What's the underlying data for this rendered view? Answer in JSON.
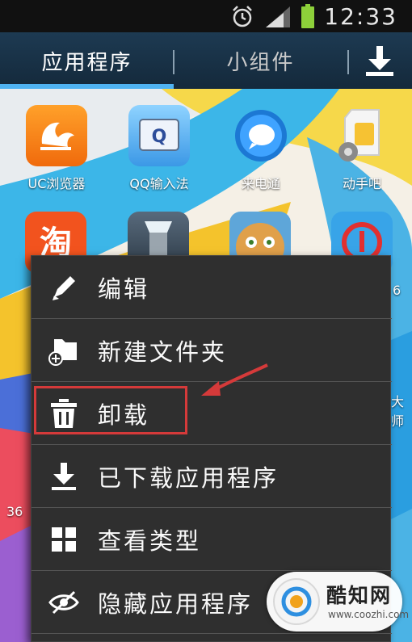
{
  "status_bar": {
    "time": "12:33",
    "icons": [
      "alarm-clock-icon",
      "signal-icon",
      "battery-icon"
    ]
  },
  "tabs": {
    "apps_label": "应用程序",
    "widgets_label": "小组件",
    "download_icon": "download-icon",
    "active_color": "#4fb3f2"
  },
  "apps_row1": [
    {
      "label": "UC浏览器",
      "icon": "uc-browser-icon"
    },
    {
      "label": "QQ输入法",
      "icon": "qq-input-icon"
    },
    {
      "label": "来电通",
      "icon": "caller-icon"
    },
    {
      "label": "动手吧",
      "icon": "sim-gear-icon"
    }
  ],
  "side_labels": {
    "right_row2": "6",
    "right_row3": "大师",
    "left_row4": "36"
  },
  "context_menu": {
    "items": [
      {
        "label": "编辑",
        "icon": "pencil-icon"
      },
      {
        "label": "新建文件夹",
        "icon": "new-folder-icon"
      },
      {
        "label": "卸载",
        "icon": "trash-icon"
      },
      {
        "label": "已下载应用程序",
        "icon": "download-icon"
      },
      {
        "label": "查看类型",
        "icon": "grid-view-icon"
      },
      {
        "label": "隐藏应用程序",
        "icon": "hide-eye-icon"
      }
    ]
  },
  "annotation": {
    "highlight_color": "#d53a3a"
  },
  "watermark": {
    "title": "酷知网",
    "url": "www.coozhi.com"
  }
}
